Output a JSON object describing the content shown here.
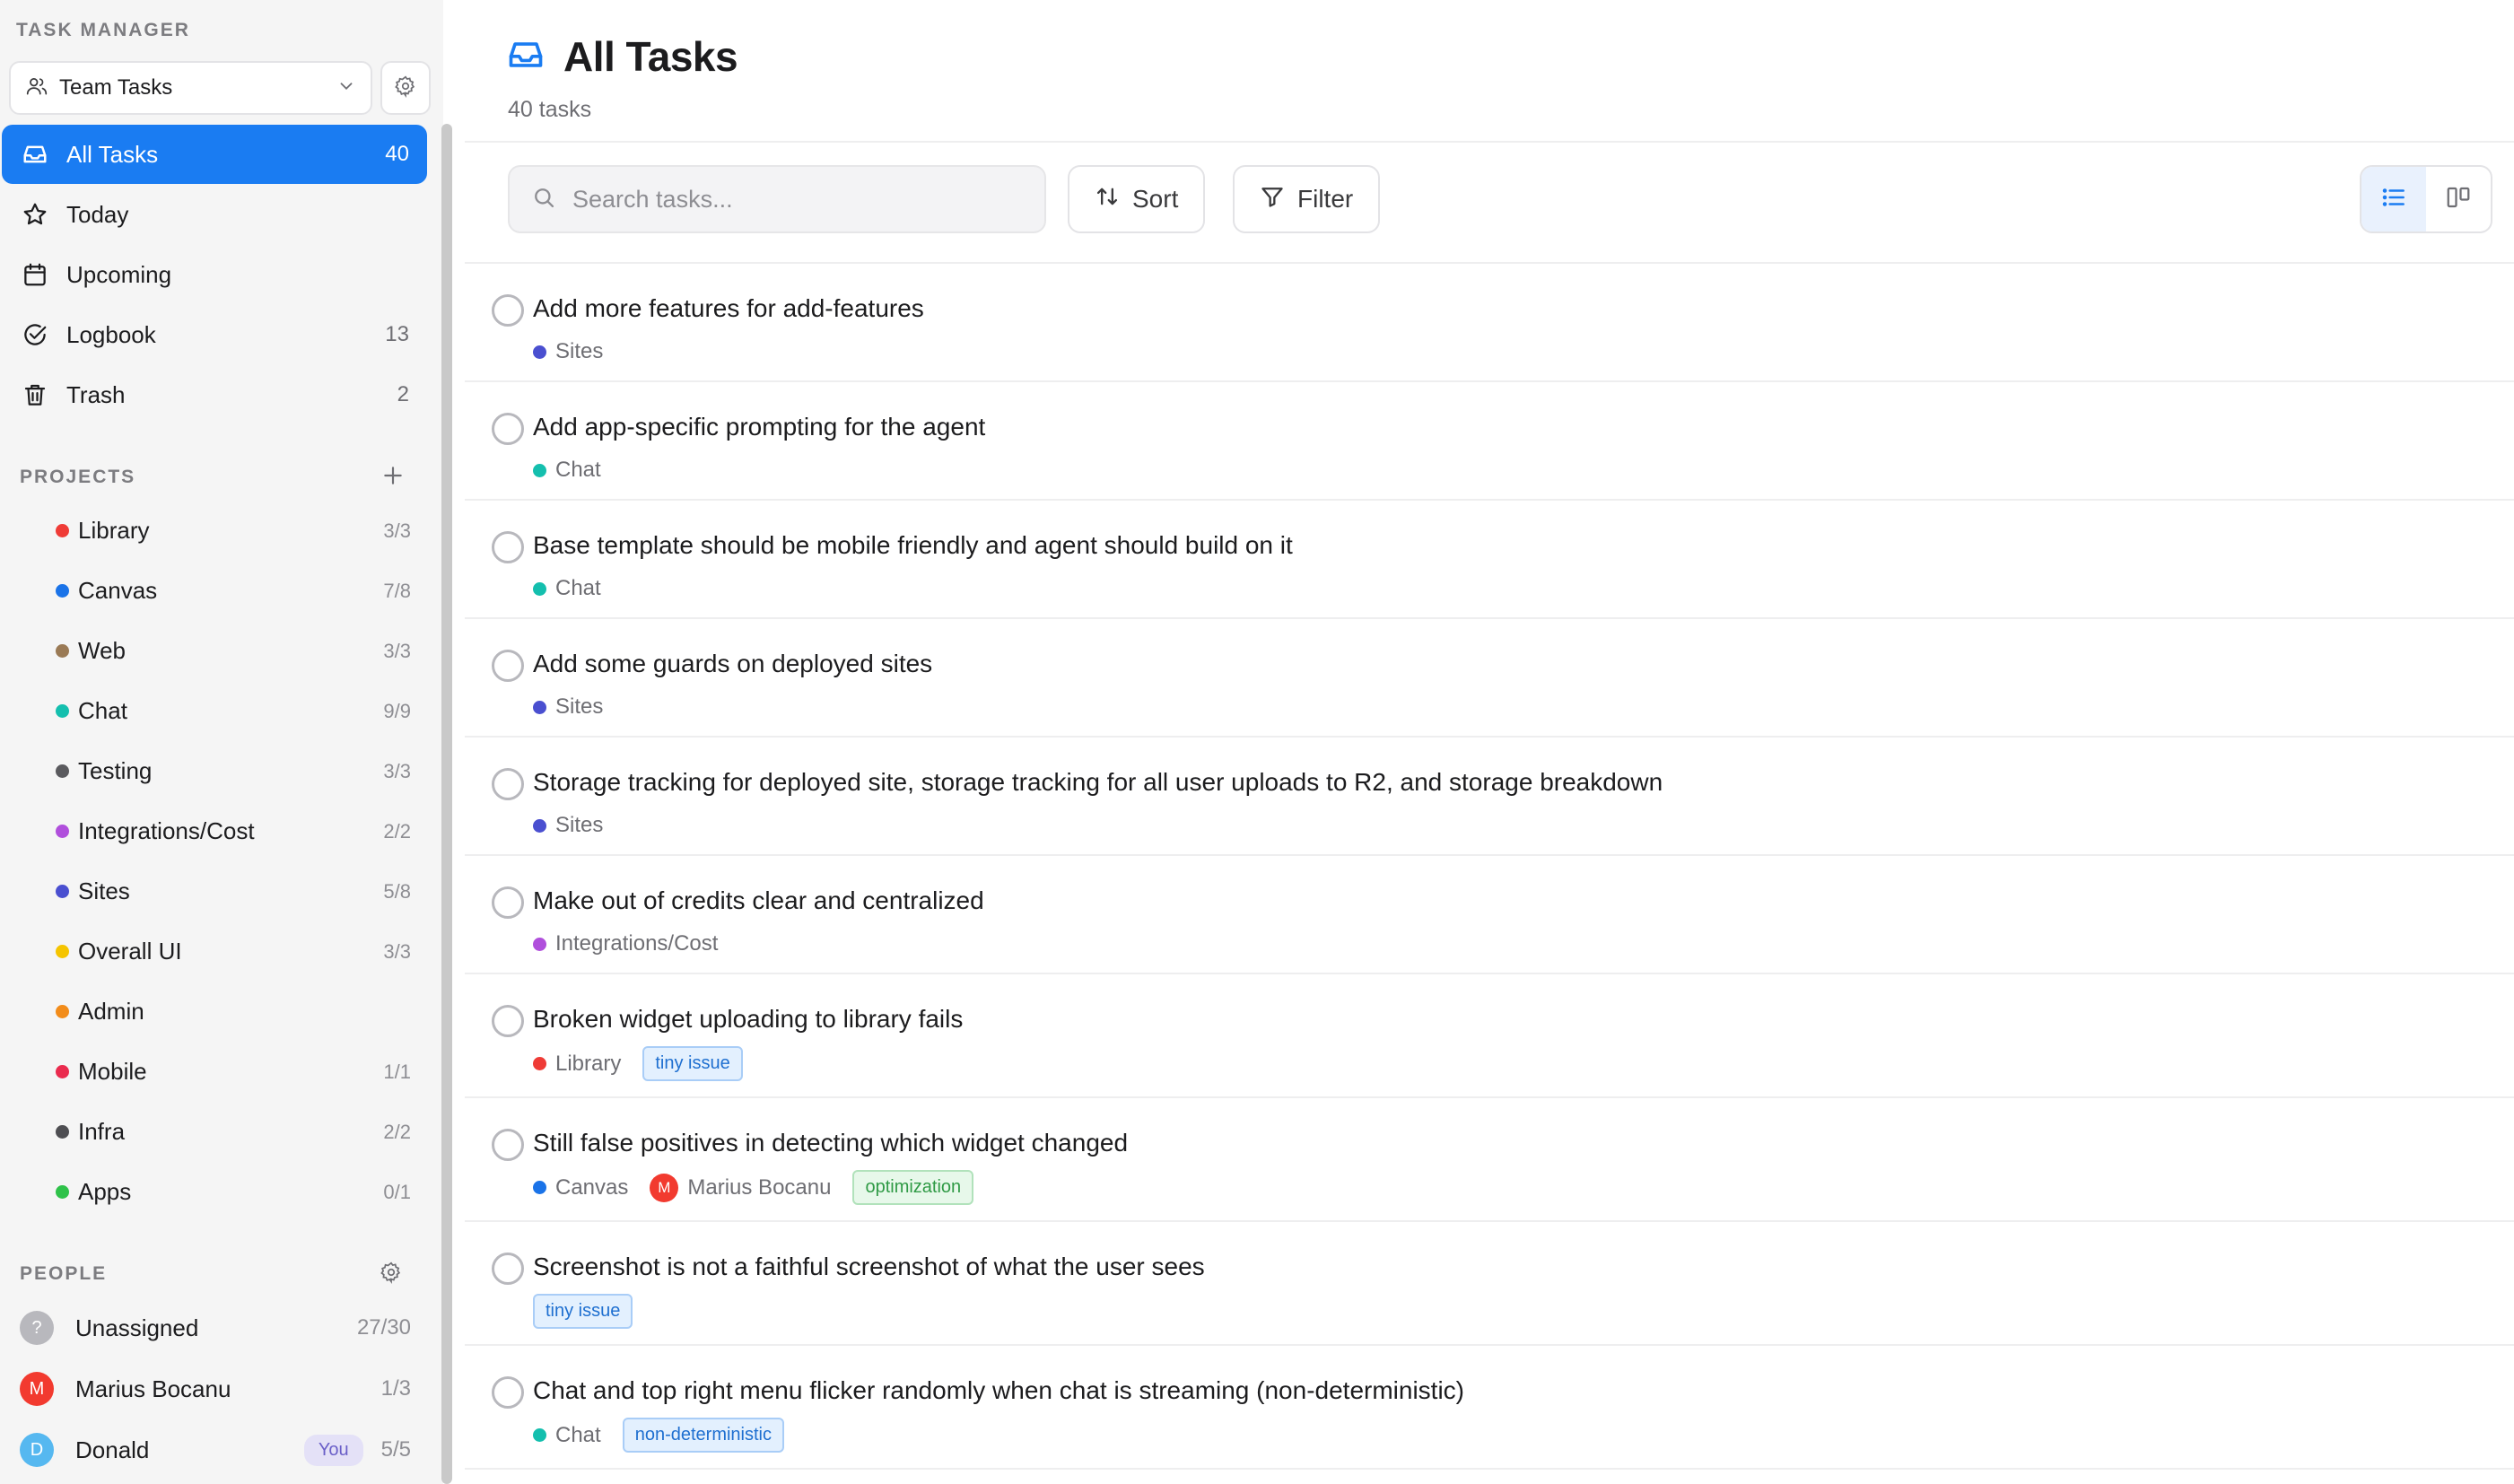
{
  "app": {
    "label": "TASK MANAGER"
  },
  "workspace": {
    "name": "Team Tasks"
  },
  "nav": [
    {
      "label": "All Tasks",
      "count": "40",
      "icon": "inbox-icon",
      "active": true
    },
    {
      "label": "Today",
      "count": "",
      "icon": "star-icon",
      "active": false
    },
    {
      "label": "Upcoming",
      "count": "",
      "icon": "calendar-icon",
      "active": false
    },
    {
      "label": "Logbook",
      "count": "13",
      "icon": "check-circle-icon",
      "active": false
    },
    {
      "label": "Trash",
      "count": "2",
      "icon": "trash-icon",
      "active": false
    }
  ],
  "projects_header": "PROJECTS",
  "projects": [
    {
      "name": "Library",
      "count": "3/3",
      "color": "#ef3b36"
    },
    {
      "name": "Canvas",
      "count": "7/8",
      "color": "#1a73e8"
    },
    {
      "name": "Web",
      "count": "3/3",
      "color": "#9a7a55"
    },
    {
      "name": "Chat",
      "count": "9/9",
      "color": "#14bfae"
    },
    {
      "name": "Testing",
      "count": "3/3",
      "color": "#5a5a5e"
    },
    {
      "name": "Integrations/Cost",
      "count": "2/2",
      "color": "#b04fdc"
    },
    {
      "name": "Sites",
      "count": "5/8",
      "color": "#4a4fd0"
    },
    {
      "name": "Overall UI",
      "count": "3/3",
      "color": "#f5c400"
    },
    {
      "name": "Admin",
      "count": "",
      "color": "#f28c1a"
    },
    {
      "name": "Mobile",
      "count": "1/1",
      "color": "#ea2b4e"
    },
    {
      "name": "Infra",
      "count": "2/2",
      "color": "#4e4e52"
    },
    {
      "name": "Apps",
      "count": "0/1",
      "color": "#2fc24a"
    }
  ],
  "people_header": "PEOPLE",
  "people": [
    {
      "name": "Unassigned",
      "initial": "?",
      "count": "27/30",
      "color": "#b8b8bd",
      "badge": ""
    },
    {
      "name": "Marius Bocanu",
      "initial": "M",
      "count": "1/3",
      "color": "#f23a2f",
      "badge": ""
    },
    {
      "name": "Donald",
      "initial": "D",
      "count": "5/5",
      "color": "#56b8f0",
      "badge": "You"
    }
  ],
  "main": {
    "title": "All Tasks",
    "subtitle": "40 tasks",
    "search_placeholder": "Search tasks...",
    "sort_label": "Sort",
    "filter_label": "Filter"
  },
  "colors": {
    "accent": "#1a7cf2"
  },
  "tasks": [
    {
      "title": "Add more features for add-features",
      "project": "Sites",
      "project_color": "#4a4fd0",
      "assignee": null,
      "tags": []
    },
    {
      "title": "Add app-specific prompting for the agent",
      "project": "Chat",
      "project_color": "#14bfae",
      "assignee": null,
      "tags": []
    },
    {
      "title": "Base template should be mobile friendly and agent should build on it",
      "project": "Chat",
      "project_color": "#14bfae",
      "assignee": null,
      "tags": []
    },
    {
      "title": "Add some guards on deployed sites",
      "project": "Sites",
      "project_color": "#4a4fd0",
      "assignee": null,
      "tags": []
    },
    {
      "title": "Storage tracking for deployed site, storage tracking for all user uploads to R2, and storage breakdown",
      "project": "Sites",
      "project_color": "#4a4fd0",
      "assignee": null,
      "tags": []
    },
    {
      "title": "Make out of credits clear and centralized",
      "project": "Integrations/Cost",
      "project_color": "#b04fdc",
      "assignee": null,
      "tags": []
    },
    {
      "title": "Broken widget uploading to library fails",
      "project": "Library",
      "project_color": "#ef3b36",
      "assignee": null,
      "tags": [
        {
          "label": "tiny issue",
          "style": "blue"
        }
      ]
    },
    {
      "title": "Still false positives in detecting which widget changed",
      "project": "Canvas",
      "project_color": "#1a73e8",
      "assignee": {
        "name": "Marius Bocanu",
        "initial": "M",
        "color": "#f23a2f"
      },
      "tags": [
        {
          "label": "optimization",
          "style": "green"
        }
      ]
    },
    {
      "title": "Screenshot is not a faithful screenshot of what the user sees",
      "project": "",
      "project_color": "",
      "assignee": null,
      "tags": [
        {
          "label": "tiny issue",
          "style": "blue"
        }
      ]
    },
    {
      "title": "Chat and top right menu flicker randomly when chat is streaming (non-deterministic)",
      "project": "Chat",
      "project_color": "#14bfae",
      "assignee": null,
      "tags": [
        {
          "label": "non-deterministic",
          "style": "blue"
        }
      ]
    }
  ]
}
